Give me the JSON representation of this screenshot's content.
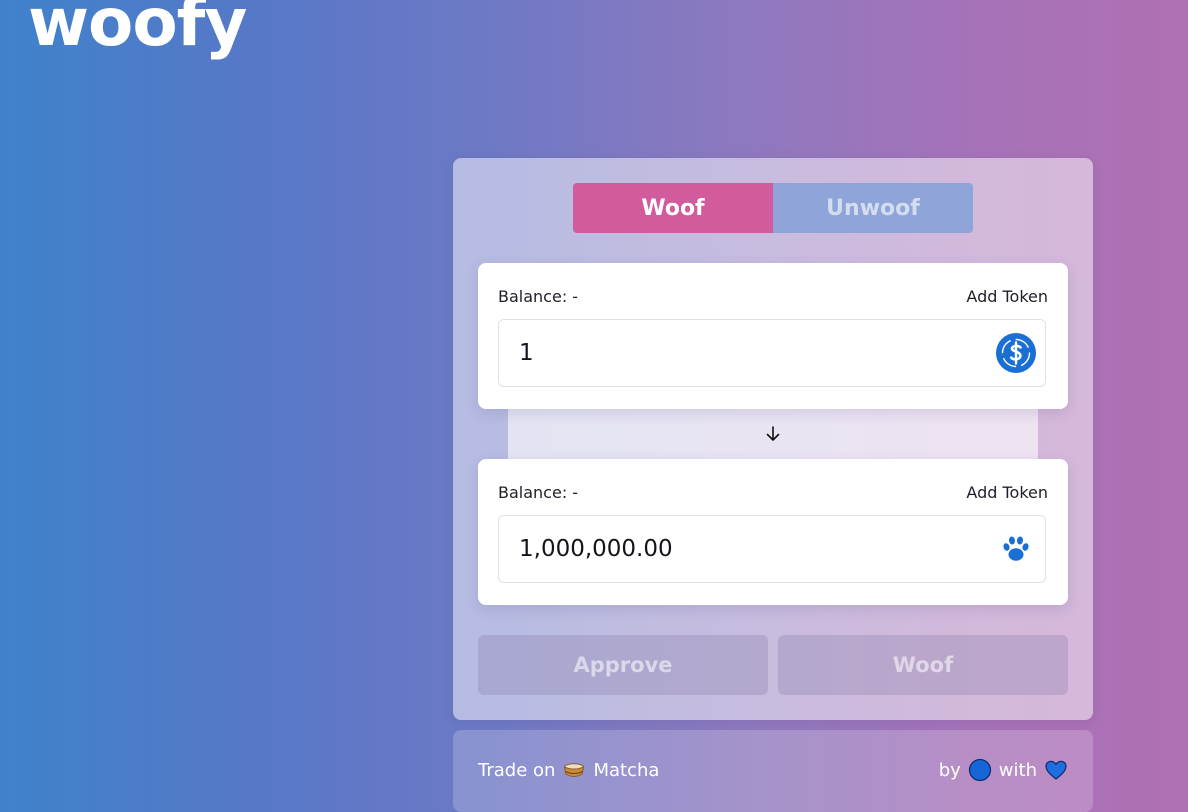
{
  "app": {
    "logo": "woofy"
  },
  "tabs": [
    {
      "label": "Woof",
      "active": true
    },
    {
      "label": "Unwoof",
      "active": false
    }
  ],
  "from_box": {
    "balance": "Balance: -",
    "add_token": "Add Token",
    "amount": "1",
    "token_icon": "yearn-dollar-coin-icon"
  },
  "to_box": {
    "balance": "Balance: -",
    "add_token": "Add Token",
    "amount": "1,000,000.00",
    "token_icon": "paw-icon"
  },
  "swap_arrow_icon": "arrow-down-icon",
  "actions": {
    "approve_label": "Approve",
    "woof_label": "Woof"
  },
  "footer": {
    "trade_on": "Trade on",
    "matcha_icon": "matcha-bowl-icon",
    "matcha": "Matcha",
    "by": "by",
    "author_icon": "blue-circle-icon",
    "with": "with",
    "heart_icon": "blue-heart-icon"
  },
  "colors": {
    "active_tab": "#d15b9c",
    "inactive_tab": "#8fa4d8",
    "token_blue": "#1a6fd4",
    "background_start": "#3f82cb",
    "background_end": "#b070b4"
  }
}
